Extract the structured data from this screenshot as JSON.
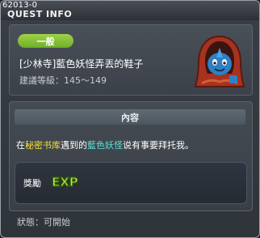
{
  "window": {
    "quest_id": "62013-0",
    "title": "QUEST INFO"
  },
  "quest": {
    "category_badge": "一般",
    "name": "[少林寺]藍色妖怪弄丟的鞋子",
    "level_text": "建議等級：145～149"
  },
  "details": {
    "header": "內容",
    "content_parts": [
      "在",
      "秘密书库",
      "遇到的",
      "藍色妖怪",
      "说有事要拜托我。"
    ],
    "reward_label": "獎勵",
    "reward_icon": "exp-icon"
  },
  "status_text": "狀態：可開始",
  "colors": {
    "badge_green": "#8cc63f",
    "highlight_yellow": "#f6e23a",
    "highlight_cyan": "#5fe0d8"
  }
}
